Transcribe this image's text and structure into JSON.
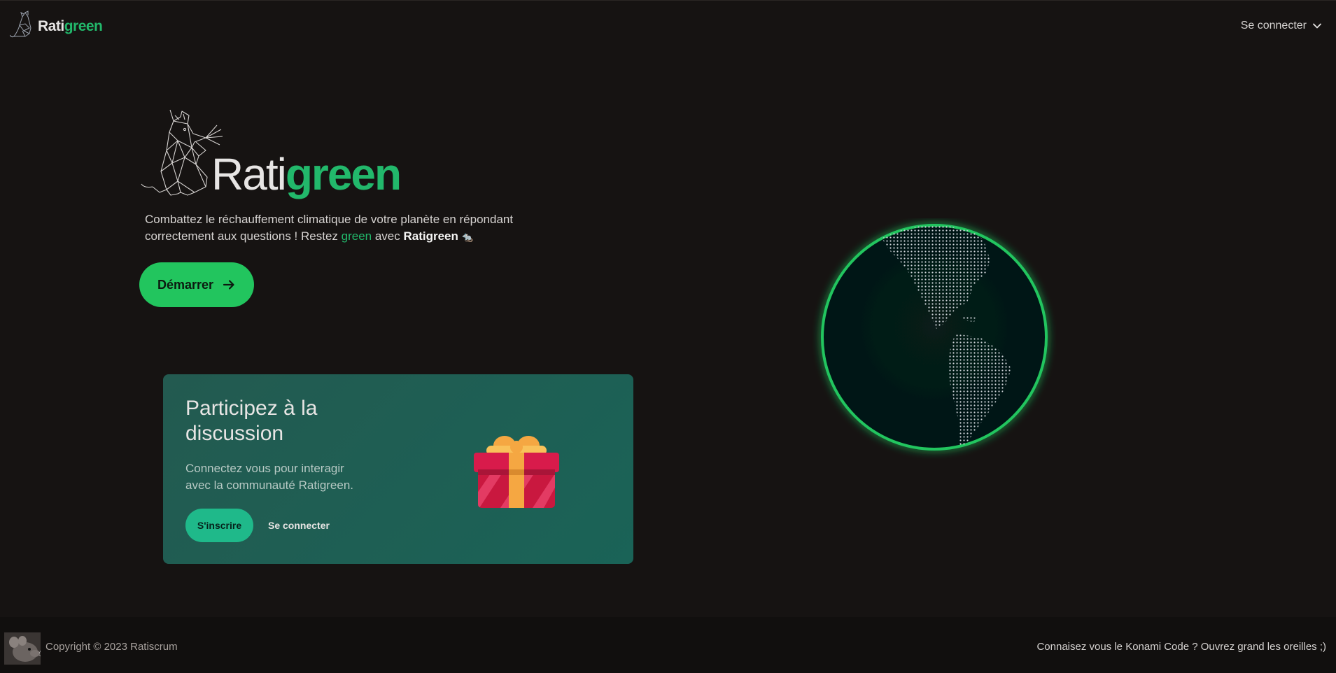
{
  "header": {
    "brand_part1": "Rati",
    "brand_part2": "green",
    "login_label": "Se connecter"
  },
  "hero": {
    "title_part1": "Rati",
    "title_part2": "green",
    "tagline_part1": "Combattez le réchauffement climatique de votre planète en répondant correctement aux questions ! Restez ",
    "tagline_green": "green",
    "tagline_part2": " avec ",
    "tagline_brand": "Ratigreen",
    "tagline_emoji": "🐀",
    "start_label": "Démarrer"
  },
  "card": {
    "title": "Participez à la discussion",
    "text": "Connectez vous pour interagir avec la communauté Ratigreen.",
    "signup_label": "S'inscrire",
    "signin_label": "Se connecter"
  },
  "footer": {
    "copyright": "Copyright © 2023 Ratiscrum",
    "konami": "Connaisez vous le Konami Code ? Ouvrez grand les oreilles ;)"
  },
  "colors": {
    "accent_green": "#22c55e",
    "brand_green": "#22b86b",
    "card_bg": "#1f5f54",
    "background": "#161312"
  }
}
